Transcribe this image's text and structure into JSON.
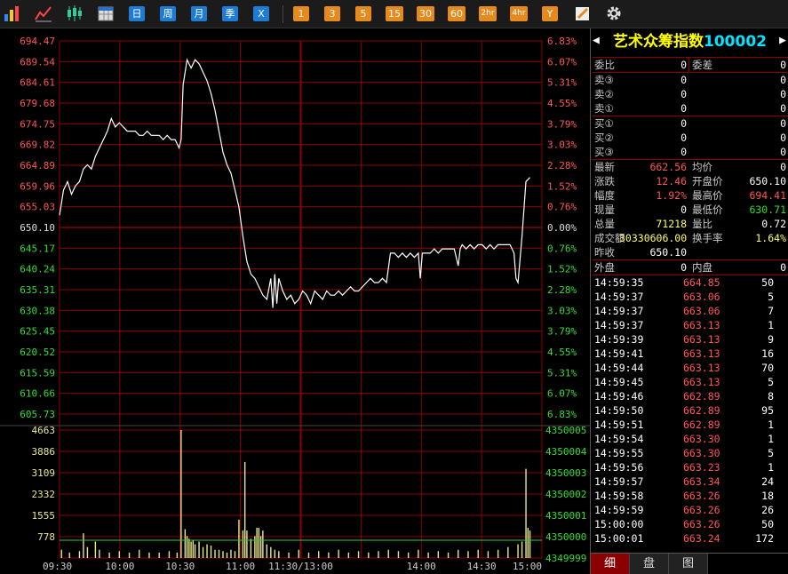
{
  "toolbar": {
    "periods": [
      "日",
      "周",
      "月",
      "季",
      "X"
    ],
    "minutes": [
      "1",
      "3",
      "5",
      "15",
      "30",
      "60",
      "2hr",
      "4hr",
      "Y"
    ]
  },
  "quote": {
    "name": "艺术众筹指数",
    "code": "100002",
    "weibi_label": "委比",
    "weibi": "0",
    "weicha_label": "委差",
    "weicha": "0",
    "sell": [
      {
        "label": "卖③",
        "price": "0",
        "vol": "0"
      },
      {
        "label": "卖②",
        "price": "0",
        "vol": "0"
      },
      {
        "label": "卖①",
        "price": "0",
        "vol": "0"
      }
    ],
    "buy": [
      {
        "label": "买①",
        "price": "0",
        "vol": "0"
      },
      {
        "label": "买②",
        "price": "0",
        "vol": "0"
      },
      {
        "label": "买③",
        "price": "0",
        "vol": "0"
      }
    ],
    "stats": [
      {
        "l1": "最新",
        "v1": "662.56",
        "c1": "r",
        "l2": "均价",
        "v2": "0",
        "c2": "w"
      },
      {
        "l1": "涨跌",
        "v1": "12.46",
        "c1": "r",
        "l2": "开盘价",
        "v2": "650.10",
        "c2": "w"
      },
      {
        "l1": "幅度",
        "v1": "1.92%",
        "c1": "r",
        "l2": "最高价",
        "v2": "694.41",
        "c2": "r"
      },
      {
        "l1": "现量",
        "v1": "0",
        "c1": "w",
        "l2": "最低价",
        "v2": "630.71",
        "c2": "g"
      },
      {
        "l1": "总量",
        "v1": "71218",
        "c1": "y",
        "l2": "量比",
        "v2": "0.72",
        "c2": "w"
      },
      {
        "l1": "成交额",
        "v1": "30330606.00",
        "c1": "y",
        "l2": "换手率",
        "v2": "1.64%",
        "c2": "y"
      },
      {
        "l1": "昨收",
        "v1": "650.10",
        "c1": "w",
        "l2": "",
        "v2": "",
        "c2": "w"
      }
    ],
    "outer_label": "外盘",
    "outer": "0",
    "inner_label": "内盘",
    "inner": "0"
  },
  "ticks": [
    [
      "14:59:35",
      "664.85",
      "50"
    ],
    [
      "14:59:37",
      "663.06",
      "5"
    ],
    [
      "14:59:37",
      "663.06",
      "7"
    ],
    [
      "14:59:37",
      "663.13",
      "1"
    ],
    [
      "14:59:39",
      "663.13",
      "9"
    ],
    [
      "14:59:41",
      "663.13",
      "16"
    ],
    [
      "14:59:44",
      "663.13",
      "70"
    ],
    [
      "14:59:45",
      "663.13",
      "5"
    ],
    [
      "14:59:46",
      "662.89",
      "8"
    ],
    [
      "14:59:50",
      "662.89",
      "95"
    ],
    [
      "14:59:51",
      "662.89",
      "1"
    ],
    [
      "14:59:54",
      "663.30",
      "1"
    ],
    [
      "14:59:55",
      "663.30",
      "5"
    ],
    [
      "14:59:56",
      "663.23",
      "1"
    ],
    [
      "14:59:57",
      "663.34",
      "24"
    ],
    [
      "14:59:58",
      "663.26",
      "18"
    ],
    [
      "14:59:59",
      "663.26",
      "26"
    ],
    [
      "15:00:00",
      "663.26",
      "50"
    ],
    [
      "15:00:01",
      "663.24",
      "172"
    ]
  ],
  "tabs": [
    "细",
    "盘",
    "图"
  ],
  "chart_data": {
    "type": "line",
    "price_ticks": [
      "694.47",
      "689.54",
      "684.61",
      "679.68",
      "674.75",
      "669.82",
      "664.89",
      "659.96",
      "655.03",
      "650.10",
      "645.17",
      "640.24",
      "635.31",
      "630.38",
      "625.45",
      "620.52",
      "615.59",
      "610.66",
      "605.73"
    ],
    "pct_ticks": [
      "6.83%",
      "6.07%",
      "5.31%",
      "4.55%",
      "3.79%",
      "3.03%",
      "2.28%",
      "1.52%",
      "0.76%",
      "0.00%",
      "0.76%",
      "1.52%",
      "2.28%",
      "3.03%",
      "3.79%",
      "4.55%",
      "5.31%",
      "6.07%",
      "6.83%"
    ],
    "prev_close": 650.1,
    "ylim": [
      605.73,
      694.47
    ],
    "vol_left_ticks": [
      "4663",
      "3886",
      "3109",
      "2332",
      "1555",
      "778"
    ],
    "vol_right_ticks": [
      "4350005",
      "4350004",
      "4350003",
      "4350002",
      "4350001",
      "4350000",
      "4349999"
    ],
    "vol_max": 4663,
    "time_labels": [
      "09:30",
      "10:00",
      "10:30",
      "11:00",
      "11:30/13:00",
      "14:00",
      "14:30",
      "15:00"
    ],
    "colors": {
      "price": "#ffffff",
      "avg": "#ffff00",
      "grid": "#8b0000",
      "vol": "#e8e890",
      "vol_avg": "#33cc33",
      "up": "#ff5555",
      "down": "#33dd33"
    },
    "price_series": [
      [
        0,
        653
      ],
      [
        2,
        659
      ],
      [
        4,
        661
      ],
      [
        6,
        658
      ],
      [
        8,
        660
      ],
      [
        10,
        661
      ],
      [
        12,
        664
      ],
      [
        14,
        665
      ],
      [
        16,
        664
      ],
      [
        18,
        667
      ],
      [
        20,
        669
      ],
      [
        22,
        671
      ],
      [
        24,
        673
      ],
      [
        26,
        676
      ],
      [
        28,
        674
      ],
      [
        30,
        675
      ],
      [
        32,
        674
      ],
      [
        34,
        673
      ],
      [
        36,
        673
      ],
      [
        38,
        673
      ],
      [
        40,
        672
      ],
      [
        42,
        672
      ],
      [
        44,
        673
      ],
      [
        46,
        672
      ],
      [
        48,
        672
      ],
      [
        50,
        672
      ],
      [
        52,
        671
      ],
      [
        54,
        672
      ],
      [
        56,
        671
      ],
      [
        58,
        671
      ],
      [
        60,
        669
      ],
      [
        61,
        671
      ],
      [
        62,
        684
      ],
      [
        64,
        690
      ],
      [
        66,
        688
      ],
      [
        68,
        690
      ],
      [
        70,
        689
      ],
      [
        72,
        687
      ],
      [
        74,
        685
      ],
      [
        76,
        682
      ],
      [
        78,
        678
      ],
      [
        80,
        673
      ],
      [
        82,
        668
      ],
      [
        84,
        665
      ],
      [
        86,
        663
      ],
      [
        88,
        659
      ],
      [
        90,
        655
      ],
      [
        92,
        648
      ],
      [
        94,
        642
      ],
      [
        96,
        639
      ],
      [
        98,
        638
      ],
      [
        100,
        636
      ],
      [
        102,
        634
      ],
      [
        104,
        633
      ],
      [
        106,
        638
      ],
      [
        107,
        631
      ],
      [
        108,
        639
      ],
      [
        109,
        632
      ],
      [
        110,
        638
      ],
      [
        112,
        635
      ],
      [
        114,
        633
      ],
      [
        116,
        634
      ],
      [
        118,
        632
      ],
      [
        120,
        633
      ],
      [
        122,
        635
      ],
      [
        124,
        634
      ],
      [
        126,
        632
      ],
      [
        128,
        635
      ],
      [
        130,
        634
      ],
      [
        132,
        633
      ],
      [
        134,
        635
      ],
      [
        136,
        634
      ],
      [
        138,
        634
      ],
      [
        140,
        635
      ],
      [
        142,
        634
      ],
      [
        144,
        635
      ],
      [
        146,
        636
      ],
      [
        148,
        635
      ],
      [
        150,
        635
      ],
      [
        152,
        636
      ],
      [
        154,
        637
      ],
      [
        156,
        638
      ],
      [
        158,
        637
      ],
      [
        160,
        637
      ],
      [
        162,
        638
      ],
      [
        164,
        637
      ],
      [
        166,
        644
      ],
      [
        168,
        644
      ],
      [
        170,
        643
      ],
      [
        172,
        644
      ],
      [
        174,
        643
      ],
      [
        176,
        644
      ],
      [
        178,
        643
      ],
      [
        180,
        644
      ],
      [
        181,
        638
      ],
      [
        182,
        644
      ],
      [
        184,
        644
      ],
      [
        186,
        644
      ],
      [
        188,
        645
      ],
      [
        190,
        644
      ],
      [
        192,
        645
      ],
      [
        194,
        645
      ],
      [
        196,
        645
      ],
      [
        198,
        645
      ],
      [
        200,
        641
      ],
      [
        201,
        645
      ],
      [
        202,
        646
      ],
      [
        204,
        645
      ],
      [
        206,
        646
      ],
      [
        208,
        645
      ],
      [
        210,
        646
      ],
      [
        212,
        646
      ],
      [
        214,
        645
      ],
      [
        216,
        646
      ],
      [
        218,
        645
      ],
      [
        220,
        646
      ],
      [
        222,
        646
      ],
      [
        224,
        646
      ],
      [
        226,
        646
      ],
      [
        228,
        644
      ],
      [
        229,
        638
      ],
      [
        230,
        637
      ],
      [
        232,
        648
      ],
      [
        234,
        661
      ],
      [
        236,
        662
      ]
    ],
    "volume_series": [
      [
        1,
        300
      ],
      [
        5,
        200
      ],
      [
        10,
        250
      ],
      [
        12,
        900
      ],
      [
        14,
        400
      ],
      [
        18,
        600
      ],
      [
        20,
        300
      ],
      [
        25,
        200
      ],
      [
        30,
        250
      ],
      [
        35,
        200
      ],
      [
        40,
        300
      ],
      [
        45,
        200
      ],
      [
        50,
        200
      ],
      [
        55,
        250
      ],
      [
        59,
        200
      ],
      [
        61,
        4663
      ],
      [
        63,
        1050
      ],
      [
        64,
        800
      ],
      [
        65,
        700
      ],
      [
        66,
        600
      ],
      [
        67,
        650
      ],
      [
        68,
        500
      ],
      [
        70,
        600
      ],
      [
        72,
        400
      ],
      [
        74,
        500
      ],
      [
        76,
        450
      ],
      [
        78,
        300
      ],
      [
        80,
        300
      ],
      [
        82,
        250
      ],
      [
        84,
        200
      ],
      [
        86,
        300
      ],
      [
        88,
        250
      ],
      [
        90,
        1400
      ],
      [
        92,
        1000
      ],
      [
        93,
        3500
      ],
      [
        94,
        1000
      ],
      [
        96,
        700
      ],
      [
        98,
        800
      ],
      [
        99,
        1100
      ],
      [
        100,
        1100
      ],
      [
        101,
        800
      ],
      [
        102,
        1000
      ],
      [
        104,
        500
      ],
      [
        106,
        400
      ],
      [
        108,
        300
      ],
      [
        110,
        250
      ],
      [
        115,
        200
      ],
      [
        120,
        300
      ],
      [
        125,
        200
      ],
      [
        130,
        250
      ],
      [
        135,
        200
      ],
      [
        140,
        300
      ],
      [
        145,
        200
      ],
      [
        150,
        250
      ],
      [
        155,
        200
      ],
      [
        160,
        250
      ],
      [
        165,
        300
      ],
      [
        170,
        250
      ],
      [
        175,
        200
      ],
      [
        180,
        300
      ],
      [
        185,
        200
      ],
      [
        190,
        250
      ],
      [
        195,
        200
      ],
      [
        200,
        300
      ],
      [
        205,
        250
      ],
      [
        210,
        300
      ],
      [
        215,
        250
      ],
      [
        220,
        300
      ],
      [
        225,
        400
      ],
      [
        230,
        500
      ],
      [
        232,
        600
      ],
      [
        234,
        3250
      ],
      [
        235,
        1100
      ],
      [
        236,
        1000
      ]
    ]
  }
}
